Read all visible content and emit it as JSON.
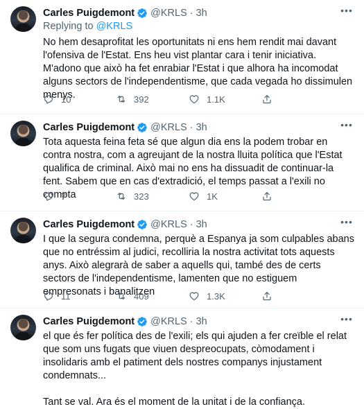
{
  "tweets": [
    {
      "name": "Carles Puigdemont",
      "handle": "@KRLS",
      "dot": "·",
      "time": "3h",
      "replying_prefix": "Replying to ",
      "replying_handle": "@KRLS",
      "text": "No hem desaprofitat les oportunitats ni ens hem rendit mai davant l'ofensiva de l'Estat. Ens heu vist plantar cara i tenir iniciativa. M'adono que això ha fet enrabiar l'Estat i que alhora ha incomodat alguns sectors de l'independentisme, que cada vegada ho dissimulen menys.",
      "replies": "10",
      "retweets": "392",
      "likes": "1.1K"
    },
    {
      "name": "Carles Puigdemont",
      "handle": "@KRLS",
      "dot": "·",
      "time": "3h",
      "text": "Tota aquesta feina feta sé que algun dia ens la podem trobar en contra nostra, com a agreujant de la nostra lluita política que l'Estat qualifica de criminal. Això mai no ens ha dissuadit de continuar-la fent. Sabem que en cas d'extradició, el temps passat a l'exili no compta",
      "replies": "7",
      "retweets": "323",
      "likes": "1K"
    },
    {
      "name": "Carles Puigdemont",
      "handle": "@KRLS",
      "dot": "·",
      "time": "3h",
      "text": "I que la segura condemna, perquè a Espanya ja som culpables abans que no entréssim al judici, recolliria la nostra activitat tots aquests anys. Això alegrarà de saber a aquells qui, també des de certs sectors de l'independentisme, lamenten que no estiguem empresonats i banalitzen",
      "replies": "11",
      "retweets": "409",
      "likes": "1.3K"
    },
    {
      "name": "Carles Puigdemont",
      "handle": "@KRLS",
      "dot": "·",
      "time": "3h",
      "text": "el que és fer política des de l'exili; els qui ajuden a fer creïble el relat que som uns fugats que viuen despreocupats, còmodament i insolidaris amb el patiment dels nostres companys injustament condemnats...",
      "text2": "Tant se val. Ara és el moment de la unitat i de la confiança."
    }
  ],
  "icons": {
    "verified": "verified-badge-icon",
    "reply": "reply-icon",
    "retweet": "retweet-icon",
    "like": "heart-icon",
    "share": "share-icon",
    "more": "more-icon"
  },
  "colors": {
    "accent": "#1d9bf0",
    "text": "#0f1419",
    "secondary": "#536471",
    "divider": "#eff3f4"
  }
}
